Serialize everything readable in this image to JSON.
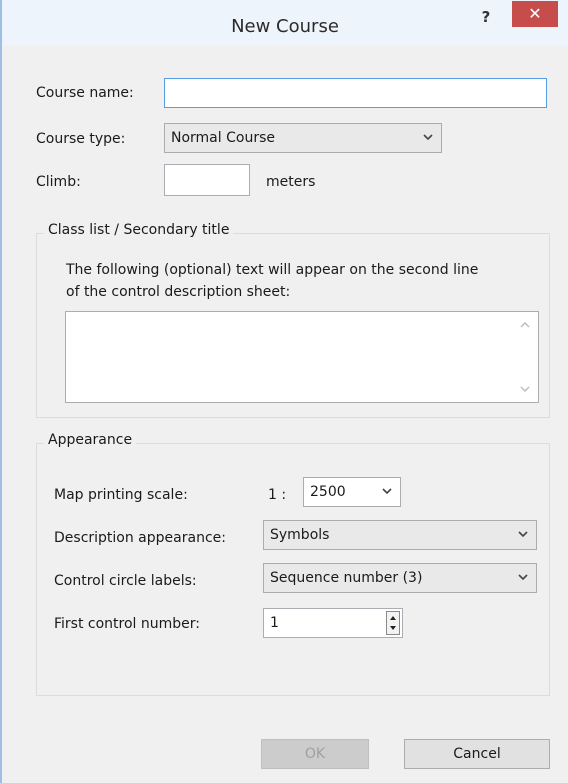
{
  "window": {
    "title": "New Course",
    "help_label": "?",
    "close_label": "✕"
  },
  "form": {
    "course_name_label": "Course name:",
    "course_name_value": "",
    "course_type_label": "Course type:",
    "course_type_value": "Normal Course",
    "climb_label": "Climb:",
    "climb_value": "",
    "climb_unit": "meters"
  },
  "class_list": {
    "group_title": "Class list / Secondary title",
    "description_line1": "The following (optional) text will appear on the second line",
    "description_line2": "of the control description sheet:",
    "text_value": ""
  },
  "appearance": {
    "group_title": "Appearance",
    "map_scale_label": "Map printing scale:",
    "map_scale_prefix": "1 :",
    "map_scale_value": "2500",
    "description_label": "Description appearance:",
    "description_value": "Symbols",
    "circle_labels_label": "Control circle labels:",
    "circle_labels_value": "Sequence number (3)",
    "first_control_label": "First control number:",
    "first_control_value": "1"
  },
  "buttons": {
    "ok_label": "OK",
    "cancel_label": "Cancel"
  }
}
